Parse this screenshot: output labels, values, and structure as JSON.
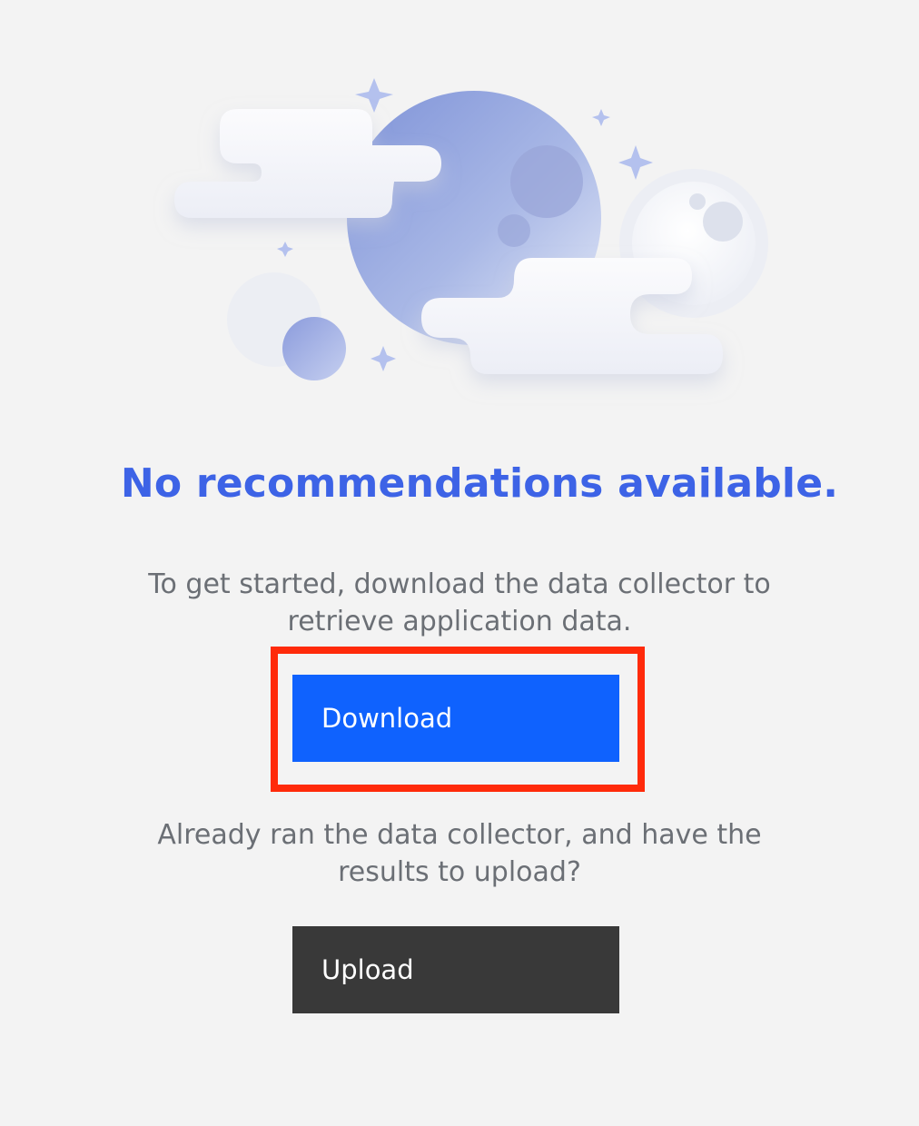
{
  "empty_state": {
    "title": "No recommendations available.",
    "description": "To get started, download the data collector to retrieve application data.",
    "download_label": "Download",
    "upload_prompt": "Already ran the data collector, and have the results to upload?",
    "upload_label": "Upload"
  },
  "illustration": {
    "subject": "moon-and-clouds-illustration"
  },
  "colors": {
    "background": "#f3f3f3",
    "title": "#3d63e6",
    "body_text": "#6b6f75",
    "primary_button": "#0f62fe",
    "secondary_button": "#393939",
    "highlight": "#ff2a0a"
  }
}
